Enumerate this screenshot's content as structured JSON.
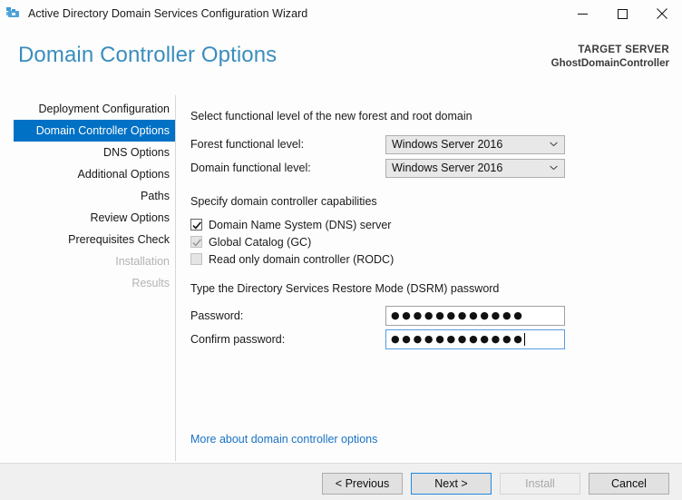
{
  "window": {
    "title": "Active Directory Domain Services Configuration Wizard",
    "icon": "server-tools-icon",
    "controls": {
      "minimize": "minimize-icon",
      "maximize": "maximize-icon",
      "close": "close-icon"
    }
  },
  "header": {
    "page_title": "Domain Controller Options",
    "target_server_label": "TARGET SERVER",
    "target_server_name": "GhostDomainController",
    "title_color": "#3a8dbe"
  },
  "sidebar": {
    "items": [
      {
        "label": "Deployment Configuration",
        "state": "normal",
        "indent": false
      },
      {
        "label": "Domain Controller Options",
        "state": "selected",
        "indent": false
      },
      {
        "label": "DNS Options",
        "state": "normal",
        "indent": true
      },
      {
        "label": "Additional Options",
        "state": "normal",
        "indent": false
      },
      {
        "label": "Paths",
        "state": "normal",
        "indent": false
      },
      {
        "label": "Review Options",
        "state": "normal",
        "indent": false
      },
      {
        "label": "Prerequisites Check",
        "state": "normal",
        "indent": false
      },
      {
        "label": "Installation",
        "state": "disabled",
        "indent": false
      },
      {
        "label": "Results",
        "state": "disabled",
        "indent": false
      }
    ],
    "selected_color": "#0071c5"
  },
  "main": {
    "functional_level": {
      "heading": "Select functional level of the new forest and root domain",
      "forest_label": "Forest functional level:",
      "forest_value": "Windows Server 2016",
      "domain_label": "Domain functional level:",
      "domain_value": "Windows Server 2016"
    },
    "capabilities": {
      "heading": "Specify domain controller capabilities",
      "options": [
        {
          "label": "Domain Name System (DNS) server",
          "checked": true,
          "enabled": true
        },
        {
          "label": "Global Catalog (GC)",
          "checked": true,
          "enabled": false
        },
        {
          "label": "Read only domain controller (RODC)",
          "checked": false,
          "enabled": false
        }
      ]
    },
    "dsrm": {
      "heading": "Type the Directory Services Restore Mode (DSRM) password",
      "password_label": "Password:",
      "password_value": "●●●●●●●●●●●●",
      "confirm_label": "Confirm password:",
      "confirm_value": "●●●●●●●●●●●●",
      "confirm_focused": true
    },
    "help_link": "More about domain controller options"
  },
  "footer": {
    "buttons": [
      {
        "label": "< Previous",
        "state": "normal"
      },
      {
        "label": "Next >",
        "state": "default"
      },
      {
        "label": "Install",
        "state": "disabled"
      },
      {
        "label": "Cancel",
        "state": "normal"
      }
    ]
  }
}
